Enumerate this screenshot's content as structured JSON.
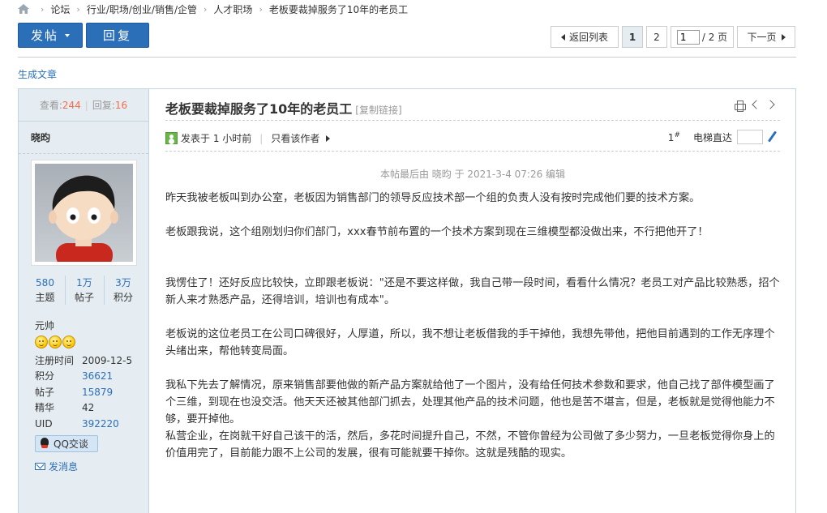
{
  "breadcrumb": {
    "items": [
      "论坛",
      "行业/职场/创业/销售/企管",
      "人才职场",
      "老板要裁掉服务了10年的老员工"
    ]
  },
  "toolbar": {
    "post_label": "发帖",
    "reply_label": "回复"
  },
  "pager": {
    "back_label": "返回列表",
    "pages": [
      "1",
      "2"
    ],
    "current_page": "1",
    "total_label": "/ 2 页",
    "next_label": "下一页"
  },
  "generate_link": "生成文章",
  "sidebar": {
    "views_label": "查看:",
    "views": "244",
    "replies_label": "回复:",
    "replies": "16",
    "username": "晓昀",
    "counts": [
      {
        "value": "580",
        "label": "主题"
      },
      {
        "value": "1万",
        "label": "帖子"
      },
      {
        "value": "3万",
        "label": "积分"
      }
    ],
    "rank": "元帅",
    "info": [
      {
        "key": "注册时间",
        "value": "2009-12-5"
      },
      {
        "key": "积分",
        "value": "36621"
      },
      {
        "key": "帖子",
        "value": "15879"
      },
      {
        "key": "精华",
        "value": "42"
      },
      {
        "key": "UID",
        "value": "392220"
      }
    ],
    "qq_label": "QQ交谈",
    "message_label": "发消息"
  },
  "post": {
    "title": "老板要裁掉服务了10年的老员工",
    "copy_link": "[复制链接]",
    "posted_at": "发表于 1 小时前",
    "only_author": "只看该作者",
    "floor": "1",
    "floor_mark": "#",
    "elevator_label": "电梯直达",
    "edited_note": "本帖最后由 晓昀 于 2021-3-4 07:26 编辑",
    "paragraphs": [
      "昨天我被老板叫到办公室，老板因为销售部门的领导反应技术部一个组的负责人没有按时完成他们要的技术方案。",
      "老板跟我说，这个组刚划归你们部门，xxx春节前布置的一个技术方案到现在三维模型都没做出来，不行把他开了！",
      "我愣住了！还好反应比较快，立即跟老板说：\"还是不要这样做，我自己带一段时间，看看什么情况？老员工对产品比较熟悉，招个新人来才熟悉产品，还得培训，培训也有成本\"。",
      "老板说的这位老员工在公司口碑很好，人厚道，所以，我不想让老板借我的手干掉他，我想先带他，把他目前遇到的工作无序理个头绪出来，帮他转变局面。",
      "我私下先去了解情况，原来销售部要他做的新产品方案就给他了一个图片，没有给任何技术参数和要求，他自己找了部件模型画了个三维，到现在也没交活。他天天还被其他部门抓去，处理其他产品的技术问题，他也是苦不堪言，但是，老板就是觉得他能力不够，要开掉他。",
      "私营企业，在岗就干好自己该干的活，然后，多花时间提升自己，不然，不管你曾经为公司做了多少努力，一旦老板觉得你身上的价值用完了，目前能力跟不上公司的发展，很有可能就要干掉你。这就是残酷的现实。"
    ]
  }
}
